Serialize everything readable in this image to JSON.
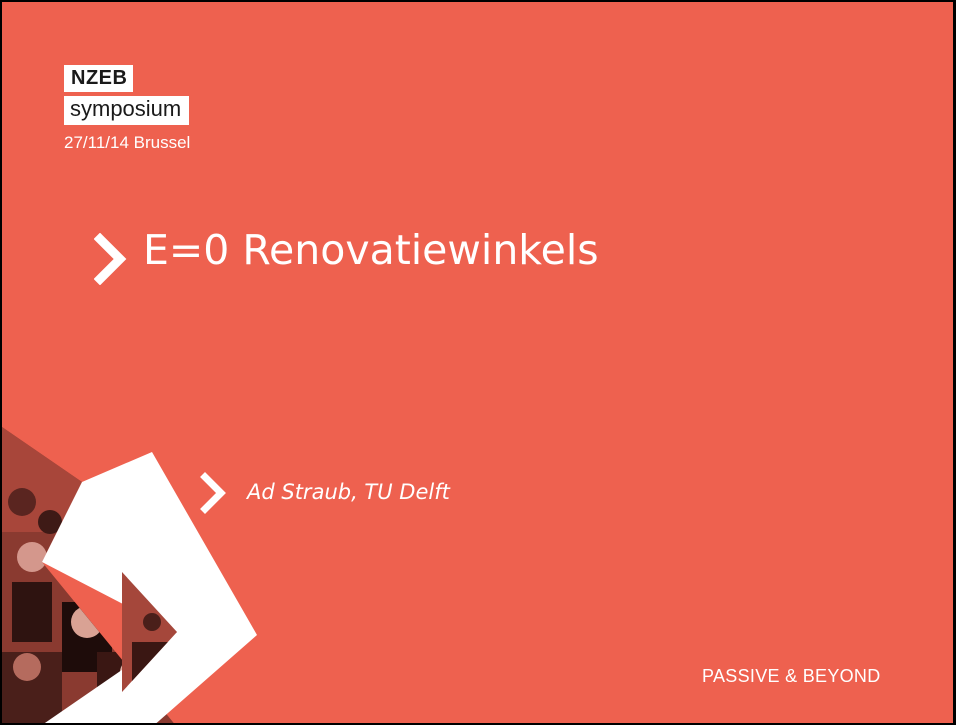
{
  "colors": {
    "background": "#ee614f",
    "text": "#ffffff",
    "logo_box": "#ffffff",
    "logo_text": "#1a1a1a"
  },
  "logo": {
    "line1": "NZEB",
    "line2": "symposium",
    "line3": "27/11/14 Brussel"
  },
  "title": {
    "icon": "chevron-right-icon",
    "text": "E=0 Renovatiewinkels"
  },
  "author": {
    "icon": "chevron-right-icon",
    "text": "Ad Straub, TU Delft"
  },
  "footer": {
    "text": "PASSIVE & BEYOND"
  }
}
